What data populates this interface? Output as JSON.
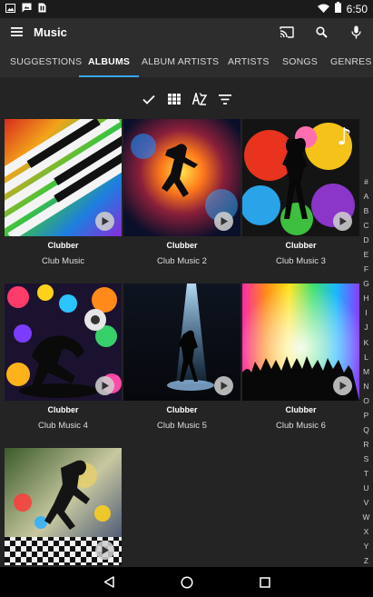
{
  "status_bar": {
    "time": "6:50",
    "icons": [
      "image-icon",
      "photo-message-icon",
      "sim-icon",
      "wifi-icon",
      "battery-icon"
    ]
  },
  "app_bar": {
    "title": "Music",
    "actions": [
      "cast-icon",
      "search-icon",
      "mic-icon"
    ]
  },
  "tabs": [
    {
      "label": "SUGGESTIONS",
      "active": false
    },
    {
      "label": "ALBUMS",
      "active": true
    },
    {
      "label": "ALBUM ARTISTS",
      "active": false
    },
    {
      "label": "ARTISTS",
      "active": false
    },
    {
      "label": "SONGS",
      "active": false
    },
    {
      "label": "GENRES",
      "active": false
    }
  ],
  "toolbar": [
    "select-all-check-icon",
    "grid-view-icon",
    "sort-az-icon",
    "filter-icon"
  ],
  "albums": [
    {
      "artist": "Clubber",
      "title": "Club Music"
    },
    {
      "artist": "Clubber",
      "title": "Club Music 2"
    },
    {
      "artist": "Clubber",
      "title": "Club Music 3"
    },
    {
      "artist": "Clubber",
      "title": "Club Music 4"
    },
    {
      "artist": "Clubber",
      "title": "Club Music 5"
    },
    {
      "artist": "Clubber",
      "title": "Club Music 6"
    },
    {
      "artist": "",
      "title": ""
    }
  ],
  "alphabet": [
    "#",
    "A",
    "B",
    "C",
    "D",
    "E",
    "F",
    "G",
    "H",
    "I",
    "J",
    "K",
    "L",
    "M",
    "N",
    "O",
    "P",
    "Q",
    "R",
    "S",
    "T",
    "U",
    "V",
    "W",
    "X",
    "Y",
    "Z"
  ],
  "nav_bar": [
    "back-icon",
    "home-icon",
    "recents-icon"
  ],
  "colors": {
    "accent": "#3ba4ff",
    "background": "#242424",
    "app_bar": "#2d2d2d"
  }
}
